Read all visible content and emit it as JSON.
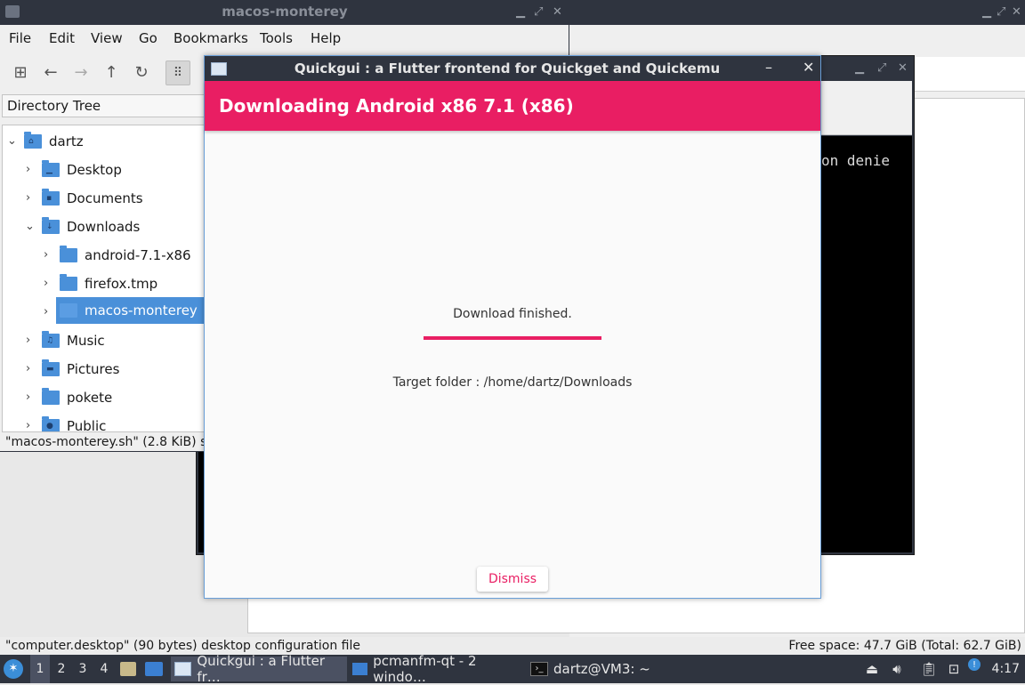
{
  "fm_back": {
    "status_right": "Free space: 47.7 GiB (Total: 62.7 GiB)",
    "status_left": "\"computer.desktop\" (90 bytes) desktop configuration file"
  },
  "terminal": {
    "visible_text": "on denie"
  },
  "fm": {
    "title": "macos-monterey",
    "menu": [
      "File",
      "Edit",
      "View",
      "Go",
      "Bookmarks",
      "Tools",
      "Help"
    ],
    "sidebar_mode": "Directory Tree",
    "tree": [
      {
        "label": "dartz",
        "icon": "home-folder-icon"
      },
      {
        "label": "Desktop",
        "icon": "desktop-folder-icon"
      },
      {
        "label": "Documents",
        "icon": "documents-folder-icon"
      },
      {
        "label": "Downloads",
        "icon": "downloads-folder-icon"
      },
      {
        "label": "android-7.1-x86",
        "icon": "folder-icon"
      },
      {
        "label": "firefox.tmp",
        "icon": "folder-icon"
      },
      {
        "label": "macos-monterey",
        "icon": "folder-icon"
      },
      {
        "label": "Music",
        "icon": "music-folder-icon"
      },
      {
        "label": "Pictures",
        "icon": "pictures-folder-icon"
      },
      {
        "label": "pokete",
        "icon": "folder-icon"
      },
      {
        "label": "Public",
        "icon": "public-folder-icon"
      }
    ],
    "status": "\"macos-monterey.sh\" (2.8 KiB) sh"
  },
  "quickgui": {
    "title": "Quickgui : a Flutter frontend for Quickget and Quickemu",
    "header": "Downloading Android x86 7.1 (x86)",
    "message": "Download finished.",
    "progress": 1.0,
    "target": "Target folder : /home/dartz/Downloads",
    "dismiss": "Dismiss",
    "accent": "#e91e63"
  },
  "taskbar": {
    "workspaces": [
      "1",
      "2",
      "3",
      "4"
    ],
    "tasks": [
      {
        "label": "Quickgui : a Flutter fr…"
      },
      {
        "label": "pcmanfm-qt - 2 windo…"
      },
      {
        "label": "dartz@VM3: ~"
      }
    ],
    "clock": "4:17"
  }
}
